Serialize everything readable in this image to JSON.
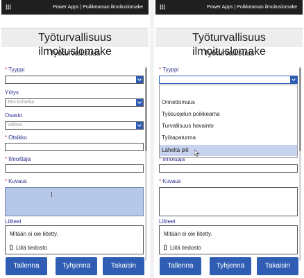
{
  "topbar": {
    "title": "Power Apps  |  Poikkeaman ilmoituslomake"
  },
  "form": {
    "title": "Työturvallisuus ilmoituslomake",
    "subtitle": "Työturvallisuus",
    "fields": {
      "tyyppi": {
        "label": "Tyyppi",
        "value": ""
      },
      "yritys": {
        "label": "Yritys",
        "placeholder": "Etsi kohteita"
      },
      "osasto": {
        "label": "Osasto",
        "placeholder": "Valitse..."
      },
      "otsikko": {
        "label": "Otsikko",
        "value": ""
      },
      "ilmoittaja": {
        "label": "Ilmoittaja",
        "value": ""
      },
      "kuvaus": {
        "label": "Kuvaus",
        "value": ""
      },
      "liitteet": {
        "label": "Liitteet",
        "empty_text": "Mitään ei ole liitetty.",
        "attach_label": "Liitä tiedosto"
      }
    },
    "buttons": {
      "save": "Tallenna",
      "clear": "Tyhjennä",
      "back": "Takaisin"
    }
  },
  "dropdown": {
    "options": [
      "Onnettomuus",
      "Työsuojelun poikkeama",
      "Turvallisuus havainto",
      "Työtapaturma",
      "Läheltä piti"
    ],
    "hovered": "Läheltä piti"
  },
  "colors": {
    "topbar": "#1f1f1f",
    "accent": "#2f5db3",
    "label": "#2c2c8c",
    "focused_field": "#b7c7e8",
    "hover_option": "#c7d3ee"
  }
}
